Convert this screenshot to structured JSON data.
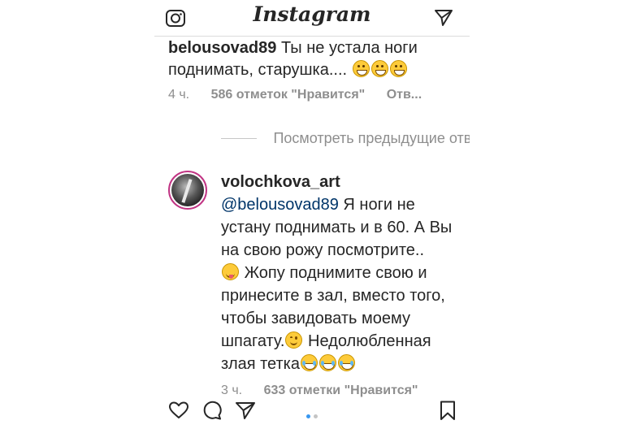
{
  "header": {
    "title": "Instagram",
    "left_icon": "camera-icon",
    "right_icon": "direct-message-icon"
  },
  "comment1": {
    "username": "belousovad89",
    "text_line1": "Ты не устала ноги",
    "text_line2": "поднимать, старушка....",
    "emoji": [
      "grinning-face",
      "grinning-face",
      "grinning-face"
    ],
    "time": "4 ч.",
    "likes": "586 отметок \"Нравится\"",
    "reply": "Отв..."
  },
  "view_previous": "Посмотреть предыдущие ответы (",
  "reply": {
    "username": "volochkova_art",
    "mention": "@belousovad89",
    "text_1": "Я ноги не",
    "text_2": "устану поднимать и в 60. А Вы",
    "text_3": "на свою рожу посмотрите..",
    "text_4": "Жопу поднимите свою и",
    "text_5": "принесите в зал, вместо того,",
    "text_6": "чтобы завидовать моему",
    "text_7": "шпагату.",
    "text_8": "Недолюбленная",
    "text_9": "злая тетка",
    "emoji": [
      "squinting-tongue-face",
      "smiling-face",
      "tears-of-joy",
      "tears-of-joy",
      "tears-of-joy"
    ],
    "time": "3 ч.",
    "likes": "633 отметки \"Нравится\""
  },
  "action_bar": {
    "icons": [
      "heart-icon",
      "comment-icon",
      "share-icon",
      "bookmark-icon"
    ],
    "active_dot_color": "#3897f0",
    "dot_color": "#c4c4c4"
  },
  "colors": {
    "text": "#262626",
    "secondary": "#8e8e8e",
    "mention": "#003569",
    "avatar_ring": "#c13584"
  }
}
